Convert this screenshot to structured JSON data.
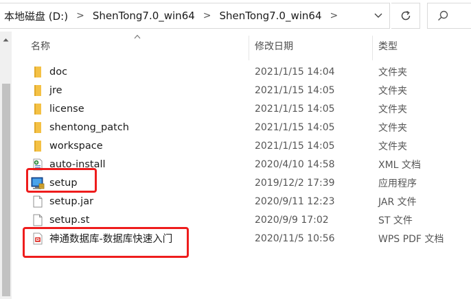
{
  "address": {
    "segments": [
      "本地磁盘 (D:)",
      "ShenTong7.0_win64",
      "ShenTong7.0_win64"
    ],
    "separator": ">",
    "dropdown_icon": "chevron-down-icon",
    "refresh_icon": "refresh-icon",
    "search_icon": "search-icon"
  },
  "columns": {
    "name": "名称",
    "modified": "修改日期",
    "type": "类型"
  },
  "files": [
    {
      "name": "doc",
      "date": "2021/1/15 14:04",
      "type": "文件夹",
      "icon": "folder-icon"
    },
    {
      "name": "jre",
      "date": "2021/1/15 14:05",
      "type": "文件夹",
      "icon": "folder-icon"
    },
    {
      "name": "license",
      "date": "2021/1/15 14:05",
      "type": "文件夹",
      "icon": "folder-icon"
    },
    {
      "name": "shentong_patch",
      "date": "2021/1/15 14:05",
      "type": "文件夹",
      "icon": "folder-icon"
    },
    {
      "name": "workspace",
      "date": "2021/1/15 14:05",
      "type": "文件夹",
      "icon": "folder-icon"
    },
    {
      "name": "auto-install",
      "date": "2020/4/10 14:58",
      "type": "XML 文档",
      "icon": "xml-file-icon"
    },
    {
      "name": "setup",
      "date": "2019/12/2 17:39",
      "type": "应用程序",
      "icon": "application-icon"
    },
    {
      "name": "setup.jar",
      "date": "2020/9/11 12:23",
      "type": "JAR 文件",
      "icon": "blank-file-icon"
    },
    {
      "name": "setup.st",
      "date": "2020/9/9 17:02",
      "type": "ST 文件",
      "icon": "blank-file-icon"
    },
    {
      "name": "神通数据库-数据库快速入门",
      "date": "2020/11/5 10:56",
      "type": "WPS PDF 文档",
      "icon": "pdf-file-icon"
    }
  ],
  "colors": {
    "highlight": "#ee1c1c",
    "folder": "#f4c145"
  }
}
